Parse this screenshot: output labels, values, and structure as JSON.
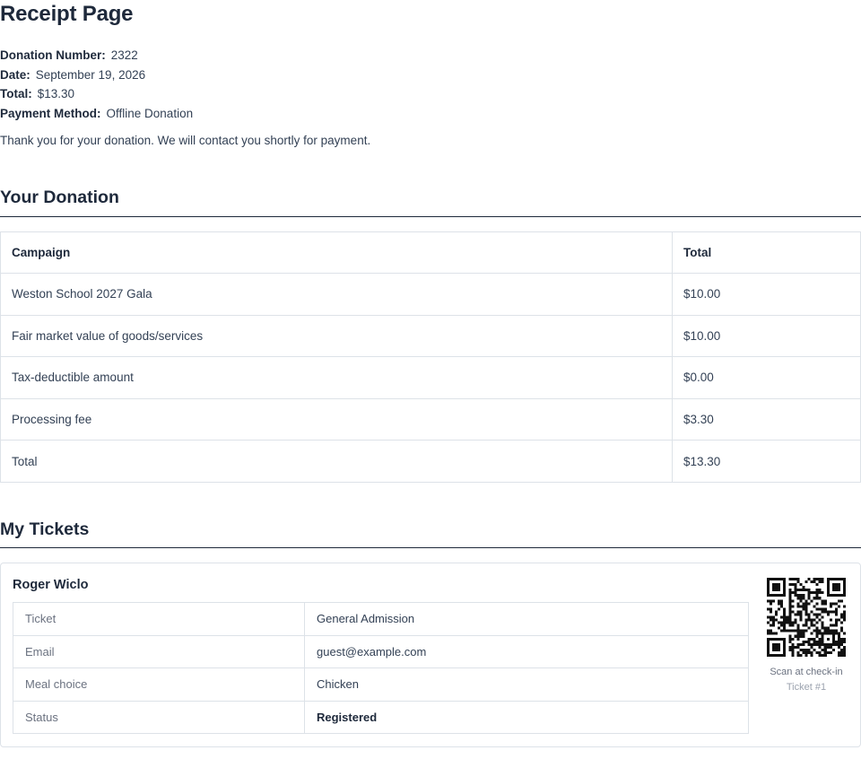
{
  "page": {
    "title": "Receipt Page"
  },
  "receipt": {
    "donation_number_label": "Donation Number:",
    "donation_number": "2322",
    "date_label": "Date:",
    "date": "September 19, 2026",
    "total_label": "Total:",
    "total": "$13.30",
    "payment_method_label": "Payment Method:",
    "payment_method": "Offline Donation",
    "thank_you": "Thank you for your donation. We will contact you shortly for payment."
  },
  "donation": {
    "heading": "Your Donation",
    "headers": [
      "Campaign",
      "Total"
    ],
    "rows": [
      [
        "Weston School 2027 Gala",
        "$10.00"
      ],
      [
        "Fair market value of goods/services",
        "$10.00"
      ],
      [
        "Tax-deductible amount",
        "$0.00"
      ],
      [
        "Processing fee",
        "$3.30"
      ],
      [
        "Total",
        "$13.30"
      ]
    ]
  },
  "tickets": {
    "heading": "My Tickets",
    "items": [
      {
        "name": "Roger Wiclo",
        "fields": [
          [
            "Ticket",
            "General Admission"
          ],
          [
            "Email",
            "guest@example.com"
          ],
          [
            "Meal choice",
            "Chicken"
          ],
          [
            "Status",
            "Registered"
          ]
        ],
        "qr_caption": "Scan at check-in",
        "qr_ticket": "Ticket #1"
      }
    ]
  }
}
